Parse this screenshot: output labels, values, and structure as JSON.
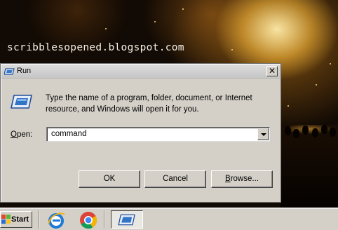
{
  "desktop": {
    "watermark": "scribblesopened.blogspot.com"
  },
  "dialog": {
    "title": "Run",
    "close_label": "✕",
    "description": "Type the name of a program, folder, document, or Internet resource, and Windows will open it for you.",
    "open_label_underlined": "O",
    "open_label_rest": "pen:",
    "open_value": "command",
    "buttons": {
      "ok": "OK",
      "cancel": "Cancel",
      "browse_underlined": "B",
      "browse_rest": "rowse..."
    },
    "icon": "run-icon"
  },
  "taskbar": {
    "start_label": "Start",
    "quick_launch": [
      "internet-explorer-icon",
      "chrome-icon"
    ],
    "tasks": [
      "run-dialog-task"
    ]
  }
}
